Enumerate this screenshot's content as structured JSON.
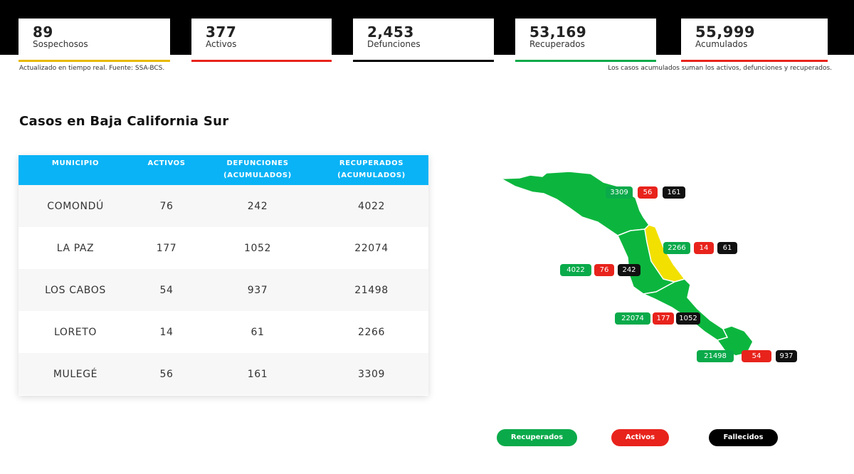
{
  "colors": {
    "sospechosos": "#e8b800",
    "activos": "#e8231c",
    "defunciones": "#000000",
    "recuperados": "#0aaa4a",
    "acumulados": "#e8231c",
    "table_header": "#0ab3f6",
    "map_green": "#0cb63e",
    "map_yellow": "#f2e000"
  },
  "stats": [
    {
      "value": "89",
      "label": "Sospechosos"
    },
    {
      "value": "377",
      "label": "Activos"
    },
    {
      "value": "2,453",
      "label": "Defunciones"
    },
    {
      "value": "53,169",
      "label": "Recuperados"
    },
    {
      "value": "55,999",
      "label": "Acumulados"
    }
  ],
  "notes": {
    "left": "Actualizado en tiempo real. Fuente: SSA-BCS.",
    "right": "Los casos acumulados suman los activos, defunciones y recuperados."
  },
  "section_title": "Casos en Baja California Sur",
  "table": {
    "headers": {
      "municipio": "MUNICIPIO",
      "activos": "ACTIVOS",
      "defunciones_1": "DEFUNCIONES",
      "defunciones_2": "(ACUMULADOS)",
      "recuperados_1": "RECUPERADOS",
      "recuperados_2": "(ACUMULADOS)"
    },
    "rows": [
      {
        "municipio": "COMONDÚ",
        "activos": "76",
        "defunciones": "242",
        "recuperados": "4022"
      },
      {
        "municipio": "LA PAZ",
        "activos": "177",
        "defunciones": "1052",
        "recuperados": "22074"
      },
      {
        "municipio": "LOS CABOS",
        "activos": "54",
        "defunciones": "937",
        "recuperados": "21498"
      },
      {
        "municipio": "LORETO",
        "activos": "14",
        "defunciones": "61",
        "recuperados": "2266"
      },
      {
        "municipio": "MULEGÉ",
        "activos": "56",
        "defunciones": "161",
        "recuperados": "3309"
      }
    ]
  },
  "map_labels": {
    "mulege": {
      "recuperados": "3309",
      "activos": "56",
      "fallecidos": "161"
    },
    "loreto": {
      "recuperados": "2266",
      "activos": "14",
      "fallecidos": "61"
    },
    "comondu": {
      "recuperados": "4022",
      "activos": "76",
      "fallecidos": "242"
    },
    "la_paz": {
      "recuperados": "22074",
      "activos": "177",
      "fallecidos": "1052"
    },
    "los_cabos": {
      "recuperados": "21498",
      "activos": "54",
      "fallecidos": "937"
    }
  },
  "legend": {
    "recuperados": "Recuperados",
    "activos": "Activos",
    "fallecidos": "Fallecidos"
  }
}
